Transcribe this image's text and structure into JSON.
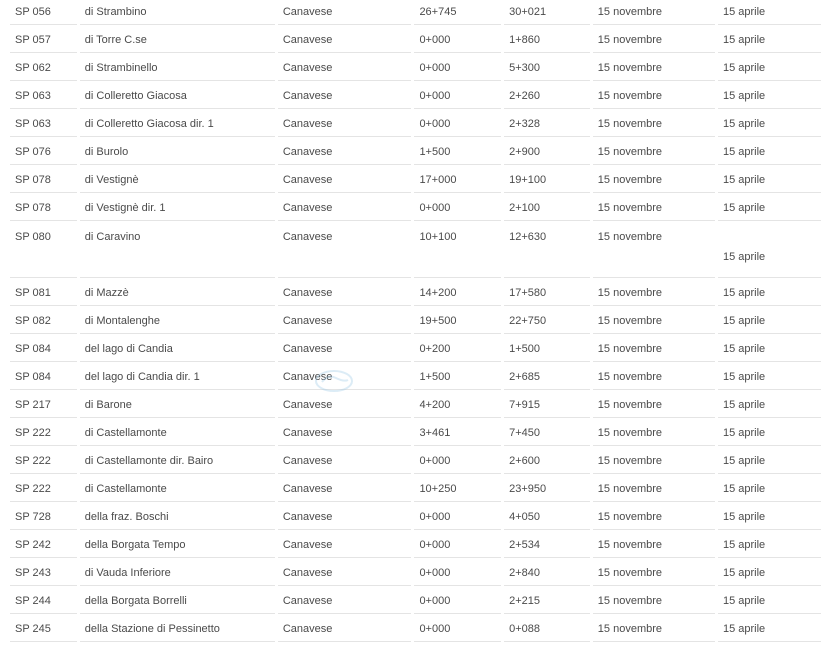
{
  "table": {
    "rows": [
      {
        "code": "SP 056",
        "name": "di Strambino",
        "zone": "Canavese",
        "from": "26+745",
        "to": "30+021",
        "start": "15 novembre",
        "end": "15 aprile"
      },
      {
        "code": "SP 057",
        "name": "di Torre C.se",
        "zone": "Canavese",
        "from": "0+000",
        "to": "1+860",
        "start": "15 novembre",
        "end": "15 aprile"
      },
      {
        "code": "SP 062",
        "name": "di Strambinello",
        "zone": "Canavese",
        "from": "0+000",
        "to": "5+300",
        "start": "15 novembre",
        "end": "15 aprile"
      },
      {
        "code": "SP 063",
        "name": "di Colleretto Giacosa",
        "zone": "Canavese",
        "from": "0+000",
        "to": "2+260",
        "start": "15 novembre",
        "end": "15 aprile"
      },
      {
        "code": "SP 063",
        "name": "di Colleretto Giacosa dir. 1",
        "zone": "Canavese",
        "from": "0+000",
        "to": "2+328",
        "start": "15 novembre",
        "end": "15 aprile"
      },
      {
        "code": "SP 076",
        "name": "di Burolo",
        "zone": "Canavese",
        "from": "1+500",
        "to": "2+900",
        "start": "15 novembre",
        "end": "15 aprile"
      },
      {
        "code": "SP 078",
        "name": "di Vestignè",
        "zone": "Canavese",
        "from": "17+000",
        "to": "19+100",
        "start": "15 novembre",
        "end": "15 aprile"
      },
      {
        "code": "SP 078",
        "name": "di Vestignè dir. 1",
        "zone": "Canavese",
        "from": "0+000",
        "to": "2+100",
        "start": "15 novembre",
        "end": "15 aprile"
      },
      {
        "code": "SP 080",
        "name": "di Caravino",
        "zone": "Canavese",
        "from": "10+100",
        "to": "12+630",
        "start": "15 novembre",
        "end": "15 aprile"
      },
      {
        "code": "SP 081",
        "name": "di Mazzè",
        "zone": "Canavese",
        "from": "14+200",
        "to": "17+580",
        "start": "15 novembre",
        "end": "15 aprile"
      },
      {
        "code": "SP 082",
        "name": "di Montalenghe",
        "zone": "Canavese",
        "from": "19+500",
        "to": "22+750",
        "start": "15 novembre",
        "end": "15 aprile"
      },
      {
        "code": "SP 084",
        "name": "del lago di Candia",
        "zone": "Canavese",
        "from": "0+200",
        "to": "1+500",
        "start": "15 novembre",
        "end": "15 aprile"
      },
      {
        "code": "SP 084",
        "name": "del lago di Candia dir. 1",
        "zone": "Canavese",
        "from": "1+500",
        "to": "2+685",
        "start": "15 novembre",
        "end": "15 aprile"
      },
      {
        "code": "SP 217",
        "name": "di Barone",
        "zone": "Canavese",
        "from": "4+200",
        "to": "7+915",
        "start": "15 novembre",
        "end": "15 aprile"
      },
      {
        "code": "SP 222",
        "name": "di Castellamonte",
        "zone": "Canavese",
        "from": "3+461",
        "to": "7+450",
        "start": "15 novembre",
        "end": "15 aprile"
      },
      {
        "code": "SP 222",
        "name": "di Castellamonte dir. Bairo",
        "zone": "Canavese",
        "from": "0+000",
        "to": "2+600",
        "start": "15 novembre",
        "end": "15 aprile"
      },
      {
        "code": "SP 222",
        "name": "di Castellamonte",
        "zone": "Canavese",
        "from": "10+250",
        "to": "23+950",
        "start": "15 novembre",
        "end": "15 aprile"
      },
      {
        "code": "SP 728",
        "name": "della fraz. Boschi",
        "zone": "Canavese",
        "from": "0+000",
        "to": "4+050",
        "start": "15 novembre",
        "end": "15 aprile"
      },
      {
        "code": "SP 242",
        "name": "della Borgata Tempo",
        "zone": "Canavese",
        "from": "0+000",
        "to": "2+534",
        "start": "15 novembre",
        "end": "15 aprile"
      },
      {
        "code": "SP 243",
        "name": "di Vauda Inferiore",
        "zone": "Canavese",
        "from": "0+000",
        "to": "2+840",
        "start": "15 novembre",
        "end": "15 aprile"
      },
      {
        "code": "SP 244",
        "name": "della Borgata Borrelli",
        "zone": "Canavese",
        "from": "0+000",
        "to": "2+215",
        "start": "15 novembre",
        "end": "15 aprile"
      },
      {
        "code": "SP 245",
        "name": "della Stazione di Pessinetto",
        "zone": "Canavese",
        "from": "0+000",
        "to": "0+088",
        "start": "15 novembre",
        "end": "15 aprile"
      }
    ]
  },
  "colors": {
    "text": "#4a4a4a",
    "row_border": "#e4e4e4",
    "watermark": "#9ec9e6"
  }
}
